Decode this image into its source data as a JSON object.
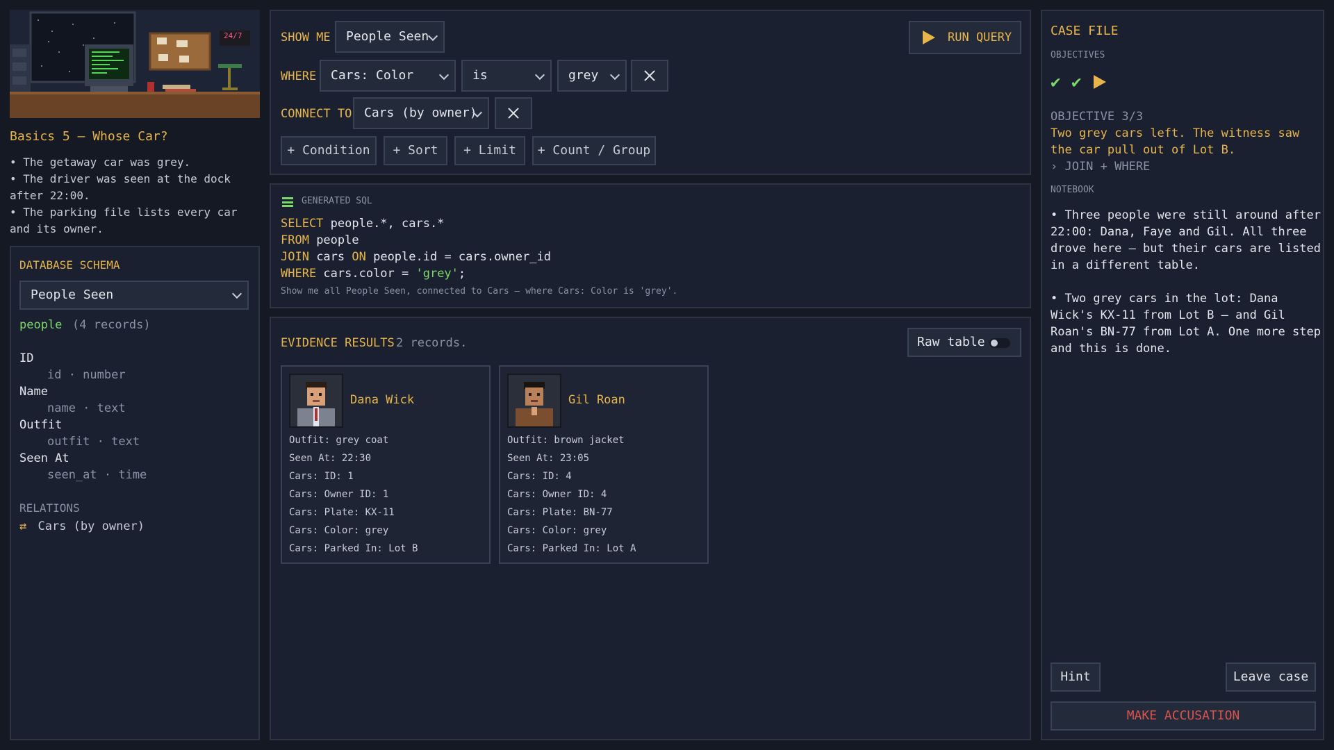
{
  "level": {
    "clock": "24/7",
    "title": "Basics 5 — Whose Car?",
    "brief": [
      "• The getaway car was grey.",
      "• The driver was seen at the dock",
      "after 22:00.",
      "• The parking file lists every car",
      "and its owner."
    ]
  },
  "schema": {
    "heading": "DATABASE SCHEMA",
    "selected_table": "People Seen",
    "table_name": "people",
    "record_count": "(4 records)",
    "fields": [
      {
        "label": "ID",
        "col": "id · number"
      },
      {
        "label": "Name",
        "col": "name · text"
      },
      {
        "label": "Outfit",
        "col": "outfit · text"
      },
      {
        "label": "Seen At",
        "col": "seen_at · time"
      }
    ],
    "relations_heading": "RELATIONS",
    "relations": [
      "Cars (by owner)"
    ]
  },
  "query": {
    "show_me_label": "SHOW ME",
    "show_me_value": "People Seen",
    "run_label": "RUN QUERY",
    "where_label": "WHERE",
    "where_field": "Cars: Color",
    "where_op": "is",
    "where_value": "grey",
    "connect_label": "CONNECT TO",
    "connect_value": "Cars (by owner)",
    "add_buttons": [
      "+ Condition",
      "+ Sort",
      "+ Limit",
      "+ Count / Group"
    ]
  },
  "sql": {
    "heading": "GENERATED SQL",
    "lines": [
      {
        "kw": "SELECT",
        "rest": " people.*, cars.*"
      },
      {
        "kw": "FROM",
        "rest": " people"
      },
      {
        "kw": "JOIN",
        "rest": " cars ",
        "kw2": "ON",
        "rest2": " people.id = cars.owner_id"
      },
      {
        "kw": "WHERE",
        "rest": " cars.color = ",
        "str": "'grey'",
        "end": ";"
      }
    ],
    "summary": "Show me all People Seen, connected to Cars — where Cars: Color is 'grey'."
  },
  "results": {
    "heading": "EVIDENCE RESULTS",
    "count": "2 records.",
    "raw_table_label": "Raw table",
    "cards": [
      {
        "name": "Dana Wick",
        "lines": [
          "Outfit: grey coat",
          "Seen At: 22:30",
          "Cars: ID: 1",
          "Cars: Owner ID: 1",
          "Cars: Plate: KX-11",
          "Cars: Color: grey",
          "Cars: Parked In: Lot B"
        ]
      },
      {
        "name": "Gil Roan",
        "lines": [
          "Outfit: brown jacket",
          "Seen At: 23:05",
          "Cars: ID: 4",
          "Cars: Owner ID: 4",
          "Cars: Plate: BN-77",
          "Cars: Color: grey",
          "Cars: Parked In: Lot A"
        ]
      }
    ]
  },
  "case_file": {
    "heading": "CASE FILE",
    "objectives_label": "OBJECTIVES",
    "objective_title": "OBJECTIVE 3/3",
    "objective_text": [
      "Two grey cars left. The witness saw",
      "the car pull out of Lot B."
    ],
    "objective_hint": "› JOIN + WHERE",
    "notebook_label": "NOTEBOOK",
    "notes": [
      [
        "• Three people were still around after",
        "22:00: Dana, Faye and Gil. All three",
        "drove here — but their cars are listed",
        "in a different table."
      ],
      [
        "• Two grey cars in the lot: Dana",
        "Wick's KX-11 from Lot B — and Gil",
        "Roan's BN-77 from Lot A. One more step",
        "and this is done."
      ]
    ],
    "hint_label": "Hint",
    "leave_label": "Leave case",
    "accuse_label": "MAKE ACCUSATION"
  },
  "colors": {
    "amber": "#e8b54a",
    "green": "#7fd86a",
    "accent_red": "#d9534f"
  }
}
